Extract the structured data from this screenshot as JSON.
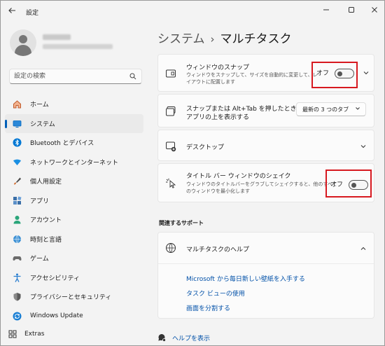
{
  "window": {
    "app_title": "設定",
    "back_icon": "arrow-left-icon",
    "controls": [
      "minimize-icon",
      "maximize-icon",
      "close-icon"
    ]
  },
  "search": {
    "placeholder": "設定の検索"
  },
  "sidebar": {
    "items": [
      {
        "label": "ホーム",
        "icon": "home-icon",
        "color": "#c05a2b"
      },
      {
        "label": "システム",
        "icon": "system-display-icon",
        "color": "#0067c0",
        "selected": true
      },
      {
        "label": "Bluetooth とデバイス",
        "icon": "bluetooth-icon",
        "color": "#0078d4"
      },
      {
        "label": "ネットワークとインターネット",
        "icon": "wifi-icon",
        "color": "#1a8fe3"
      },
      {
        "label": "個人用設定",
        "icon": "brush-icon",
        "color": "#d4743a"
      },
      {
        "label": "アプリ",
        "icon": "apps-icon",
        "color": "#3a6fa8"
      },
      {
        "label": "アカウント",
        "icon": "account-icon",
        "color": "#2aa57a"
      },
      {
        "label": "時刻と言語",
        "icon": "globe-clock-icon",
        "color": "#3a8fd4"
      },
      {
        "label": "ゲーム",
        "icon": "gamepad-icon",
        "color": "#6b6b6b"
      },
      {
        "label": "アクセシビリティ",
        "icon": "accessibility-icon",
        "color": "#2b7fd0"
      },
      {
        "label": "プライバシーとセキュリティ",
        "icon": "shield-icon",
        "color": "#6b6b6b"
      },
      {
        "label": "Windows Update",
        "icon": "windows-update-icon",
        "color": "#1a7fd4"
      }
    ],
    "extras_label": "Extras"
  },
  "breadcrumb": {
    "parent": "システム",
    "separator": "›",
    "current": "マルチタスク"
  },
  "cards": {
    "snap": {
      "title": "ウィンドウのスナップ",
      "desc_line1": "ウィンドウをスナップして、サイズを自動的に変更して、レ",
      "desc_line2": "イアウトに配置します",
      "toggle_label": "オフ",
      "toggle_on": false
    },
    "snap_tabs": {
      "title_line1": "スナップまたは Alt+Tab を押したときに",
      "title_line2": "アプリの上を表示する",
      "dropdown_value": "最新の 3 つのタブ"
    },
    "desktops": {
      "title": "デスクトップ"
    },
    "shake": {
      "title": "タイトル バー ウィンドウのシェイク",
      "desc_line1": "ウィンドウのタイトルバーをグラブしてシェイクすると、他のすべて",
      "desc_line2": "のウィンドウを最小化します",
      "toggle_label": "オフ",
      "toggle_on": false
    }
  },
  "support": {
    "section_title": "関連するサポート",
    "help_title": "マルチタスクのヘルプ",
    "links": [
      "Microsoft から毎日新しい壁紙を入手する",
      "タスク ビューの使用",
      "画面を分割する"
    ]
  },
  "bottom": {
    "help_label": "ヘルプを表示"
  },
  "colors": {
    "accent": "#005fb8",
    "link": "#0050a8",
    "highlight_box": "#d71920"
  }
}
